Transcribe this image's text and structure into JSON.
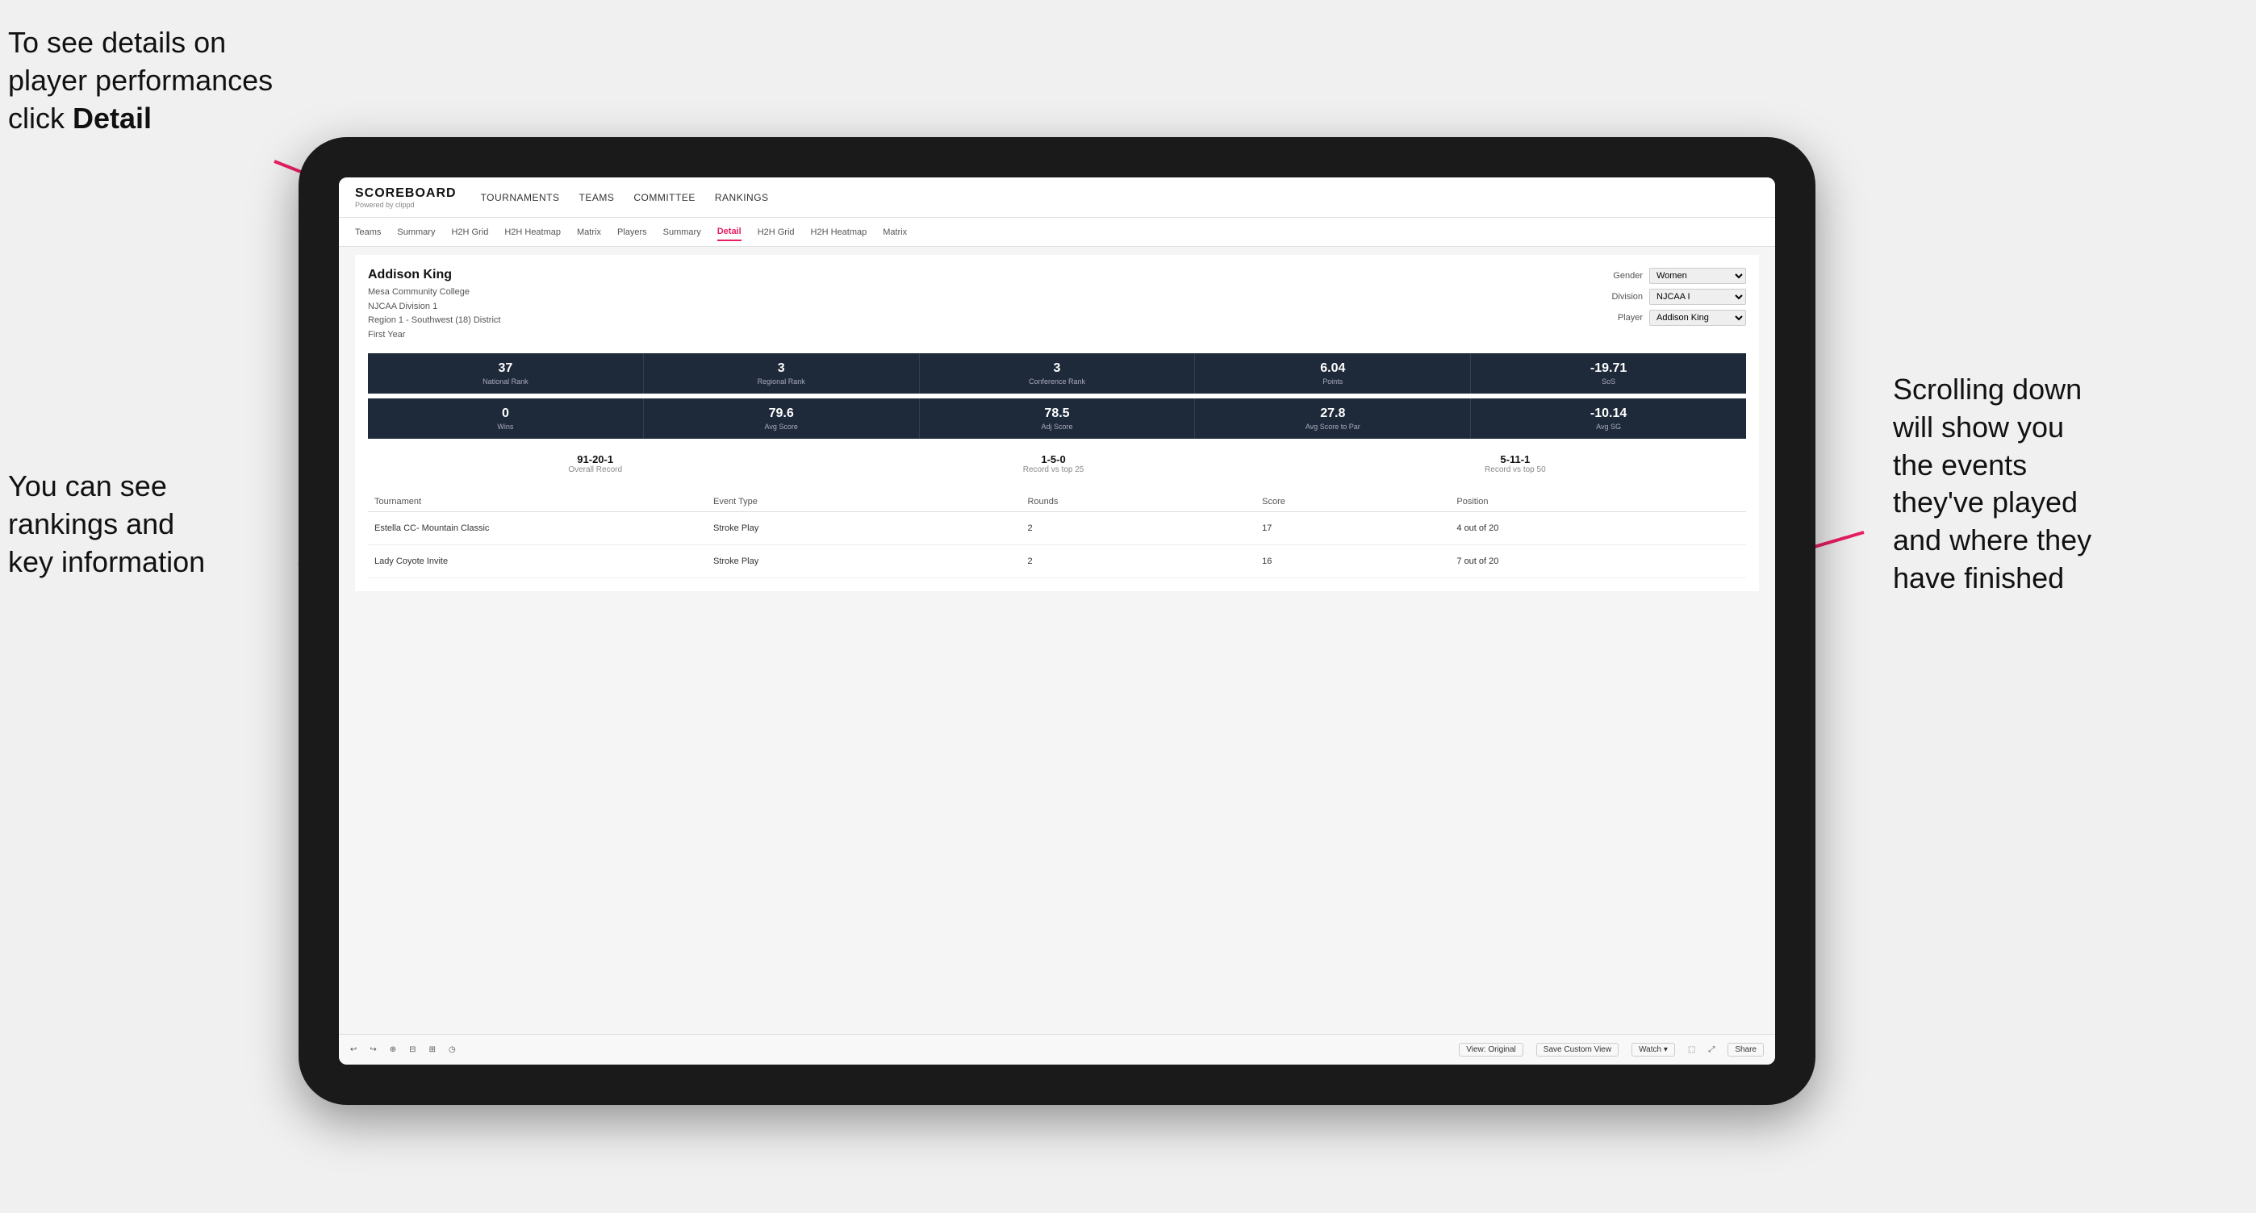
{
  "annotations": {
    "top_left": "To see details on player performances click ",
    "top_left_bold": "Detail",
    "bottom_left_line1": "You can see",
    "bottom_left_line2": "rankings and",
    "bottom_left_line3": "key information",
    "right_line1": "Scrolling down",
    "right_line2": "will show you",
    "right_line3": "the events",
    "right_line4": "they've played",
    "right_line5": "and where they",
    "right_line6": "have finished"
  },
  "top_nav": {
    "logo_title": "SCOREBOARD",
    "logo_subtitle": "Powered by clippd",
    "items": [
      {
        "label": "TOURNAMENTS",
        "active": false
      },
      {
        "label": "TEAMS",
        "active": false
      },
      {
        "label": "COMMITTEE",
        "active": false
      },
      {
        "label": "RANKINGS",
        "active": false
      }
    ]
  },
  "second_nav": {
    "items": [
      {
        "label": "Teams",
        "active": false
      },
      {
        "label": "Summary",
        "active": false
      },
      {
        "label": "H2H Grid",
        "active": false
      },
      {
        "label": "H2H Heatmap",
        "active": false
      },
      {
        "label": "Matrix",
        "active": false
      },
      {
        "label": "Players",
        "active": false
      },
      {
        "label": "Summary",
        "active": false
      },
      {
        "label": "Detail",
        "active": true
      },
      {
        "label": "H2H Grid",
        "active": false
      },
      {
        "label": "H2H Heatmap",
        "active": false
      },
      {
        "label": "Matrix",
        "active": false
      }
    ]
  },
  "player": {
    "name": "Addison King",
    "college": "Mesa Community College",
    "division": "NJCAA Division 1",
    "region": "Region 1 - Southwest (18) District",
    "year": "First Year",
    "filters": {
      "gender_label": "Gender",
      "gender_value": "Women",
      "division_label": "Division",
      "division_value": "NJCAA I",
      "player_label": "Player",
      "player_value": "Addison King"
    }
  },
  "stats_row1": [
    {
      "value": "37",
      "label": "National Rank"
    },
    {
      "value": "3",
      "label": "Regional Rank"
    },
    {
      "value": "3",
      "label": "Conference Rank"
    },
    {
      "value": "6.04",
      "label": "Points"
    },
    {
      "value": "-19.71",
      "label": "SoS"
    }
  ],
  "stats_row2": [
    {
      "value": "0",
      "label": "Wins"
    },
    {
      "value": "79.6",
      "label": "Avg Score"
    },
    {
      "value": "78.5",
      "label": "Adj Score"
    },
    {
      "value": "27.8",
      "label": "Avg Score to Par"
    },
    {
      "value": "-10.14",
      "label": "Avg SG"
    }
  ],
  "records": [
    {
      "value": "91-20-1",
      "label": "Overall Record"
    },
    {
      "value": "1-5-0",
      "label": "Record vs top 25"
    },
    {
      "value": "5-11-1",
      "label": "Record vs top 50"
    }
  ],
  "table": {
    "headers": [
      "Tournament",
      "",
      "Event Type",
      "Rounds",
      "Score",
      "Position"
    ],
    "rows": [
      {
        "tournament": "Estella CC- Mountain Classic",
        "event_type": "Stroke Play",
        "rounds": "2",
        "score": "17",
        "position": "4 out of 20"
      },
      {
        "tournament": "Lady Coyote Invite",
        "event_type": "Stroke Play",
        "rounds": "2",
        "score": "16",
        "position": "7 out of 20"
      }
    ]
  },
  "toolbar": {
    "undo": "↩",
    "redo": "↪",
    "view_original": "View: Original",
    "save_custom": "Save Custom View",
    "watch": "Watch ▾",
    "share": "Share"
  }
}
